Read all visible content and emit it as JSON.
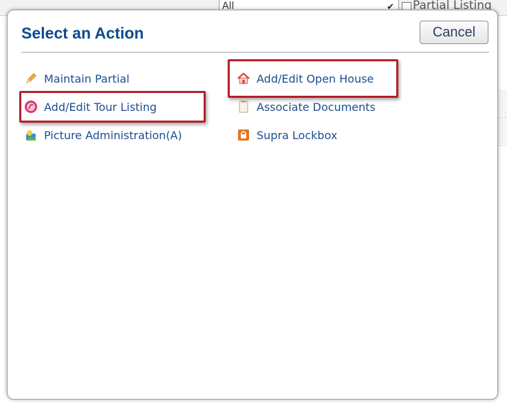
{
  "background": {
    "select_value": "All",
    "checkbox_label": "Partial Listing"
  },
  "dialog": {
    "title": "Select an Action",
    "cancel_label": "Cancel"
  },
  "actions": [
    {
      "label": "Maintain Partial",
      "icon": "pencil-icon"
    },
    {
      "label": "Add/Edit Tour Listing",
      "icon": "tour-icon"
    },
    {
      "label": "Picture Administration(A)",
      "icon": "picture-icon"
    },
    {
      "label": "Add/Edit Open House",
      "icon": "house-icon"
    },
    {
      "label": "Associate Documents",
      "icon": "document-icon"
    },
    {
      "label": "Supra Lockbox",
      "icon": "lockbox-icon"
    }
  ],
  "colors": {
    "title": "#0d4a8c",
    "link": "#1c4e8e",
    "highlight": "#b51f2a"
  }
}
